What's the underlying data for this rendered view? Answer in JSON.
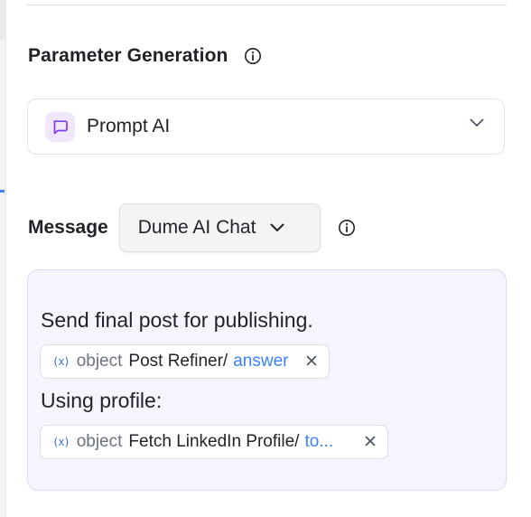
{
  "parameter_generation": {
    "title": "Parameter Generation",
    "info_icon": "info-circle-icon",
    "selected": "Prompt AI",
    "selected_icon": "chat-bubble-icon",
    "chevron_icon": "chevron-down-icon"
  },
  "message": {
    "label": "Message",
    "source": "Dume AI Chat",
    "source_chevron_icon": "chevron-down-icon",
    "info_icon": "info-circle-icon",
    "line_1": "Send final post for publishing.",
    "line_2": "Using profile:",
    "variables": [
      {
        "icon": "(x)",
        "type": "object",
        "path": "Post Refiner/",
        "field": "answer",
        "close_icon": "close-icon"
      },
      {
        "icon": "(x)",
        "type": "object",
        "path": "Fetch LinkedIn Profile/",
        "field": "to...",
        "close_icon": "close-icon"
      }
    ]
  },
  "colors": {
    "accent_purple": "#7c3aed",
    "link_blue": "#3b82f6",
    "message_bg": "#f8f4fe",
    "badge_bg": "#f1e7fd"
  }
}
